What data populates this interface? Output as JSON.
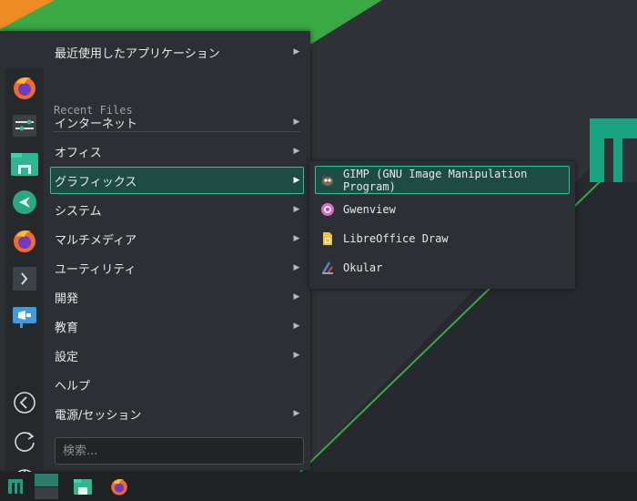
{
  "menu": {
    "recent_apps": "最近使用したアプリケーション",
    "recent_files": "Recent Files",
    "categories": [
      {
        "label": "インターネット"
      },
      {
        "label": "オフィス"
      },
      {
        "label": "グラフィックス"
      },
      {
        "label": "システム"
      },
      {
        "label": "マルチメディア"
      },
      {
        "label": "ユーティリティ"
      },
      {
        "label": "開発"
      },
      {
        "label": "教育"
      },
      {
        "label": "設定"
      },
      {
        "label": "ヘルプ"
      },
      {
        "label": "電源/セッション"
      }
    ],
    "active_category": "グラフィックス",
    "search_placeholder": "検索..."
  },
  "submenu": {
    "items": [
      {
        "label": "GIMP (GNU Image Manipulation Program)",
        "icon": "gimp-icon"
      },
      {
        "label": "Gwenview",
        "icon": "gwenview-icon"
      },
      {
        "label": "LibreOffice Draw",
        "icon": "libreoffice-draw-icon"
      },
      {
        "label": "Okular",
        "icon": "okular-icon"
      }
    ]
  },
  "favorites": [
    "firefox-icon",
    "system-settings-icon",
    "file-manager-icon",
    "manjaro-hello-icon",
    "firefox-icon",
    "terminal-icon",
    "announcement-icon"
  ],
  "session_buttons": [
    "back-icon",
    "restart-icon",
    "power-icon"
  ],
  "taskbar": [
    "manjaro-menu-icon",
    "desktop-icon",
    "file-manager-icon",
    "firefox-icon"
  ],
  "colors": {
    "accent": "#35bf9d",
    "highlight_bg": "#1d4c44",
    "menu_bg": "#2c3034",
    "desktop_green": "#3aa845",
    "orange": "#f08a23"
  }
}
